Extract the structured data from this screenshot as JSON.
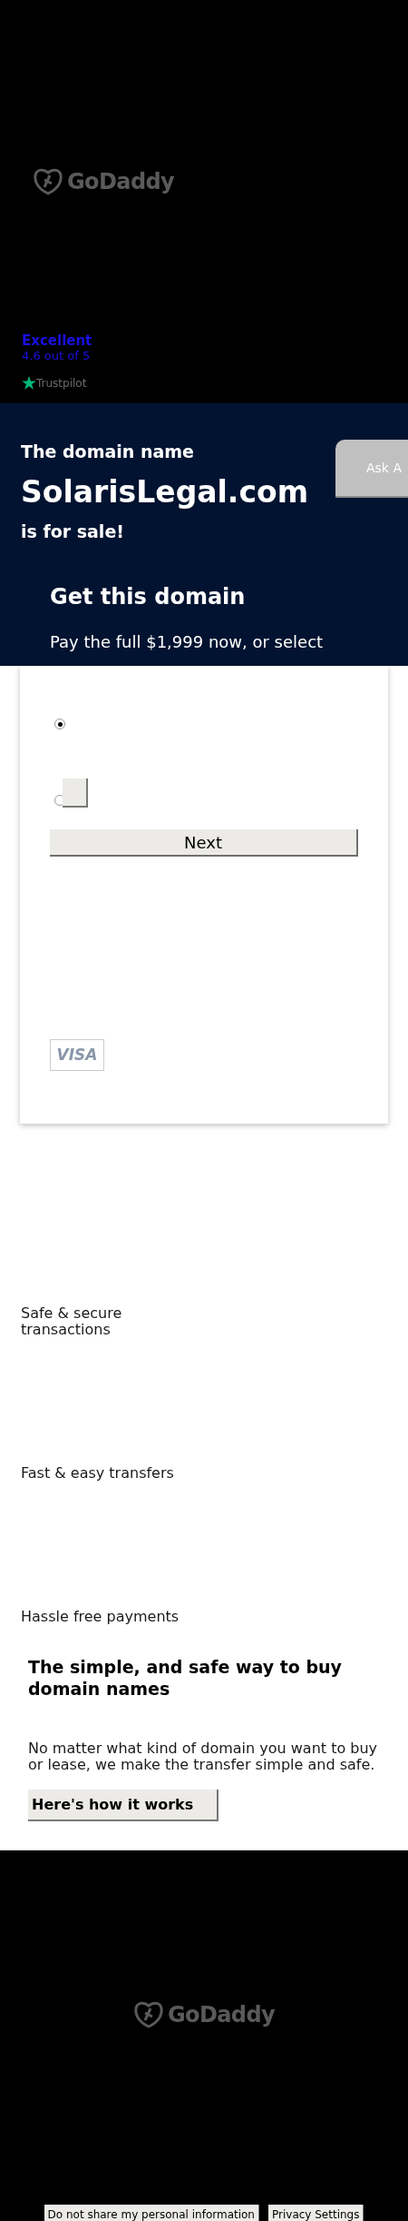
{
  "header": {
    "logo": "GoDaddy",
    "rating": {
      "label": "Excellent",
      "score": "4.6 out of 5",
      "source": "Trustpilot"
    }
  },
  "hero": {
    "intro": "The domain name",
    "domain": "SolarisLegal.com",
    "outro": "is for sale!",
    "ask_button": "Ask A"
  },
  "purchase_card": {
    "title": "Get this domain",
    "description": "Pay the full $1,999 now, or select",
    "options": [
      {
        "kind": "plain",
        "selected": true
      },
      {
        "kind": "with-button",
        "selected": false
      }
    ],
    "next_button": "Next",
    "card_badge": "VISA"
  },
  "features": [
    "Safe & secure transactions",
    "Fast & easy transfers",
    "Hassle free payments"
  ],
  "info": {
    "heading": "The simple, and safe way to buy domain names",
    "text": "No matter what kind of domain you want to buy or lease, we make the transfer simple and safe.",
    "button": "Here's how it works"
  },
  "footer": {
    "logo": "GoDaddy",
    "buttons": [
      "Do not share my personal information",
      "Privacy Settings"
    ]
  }
}
